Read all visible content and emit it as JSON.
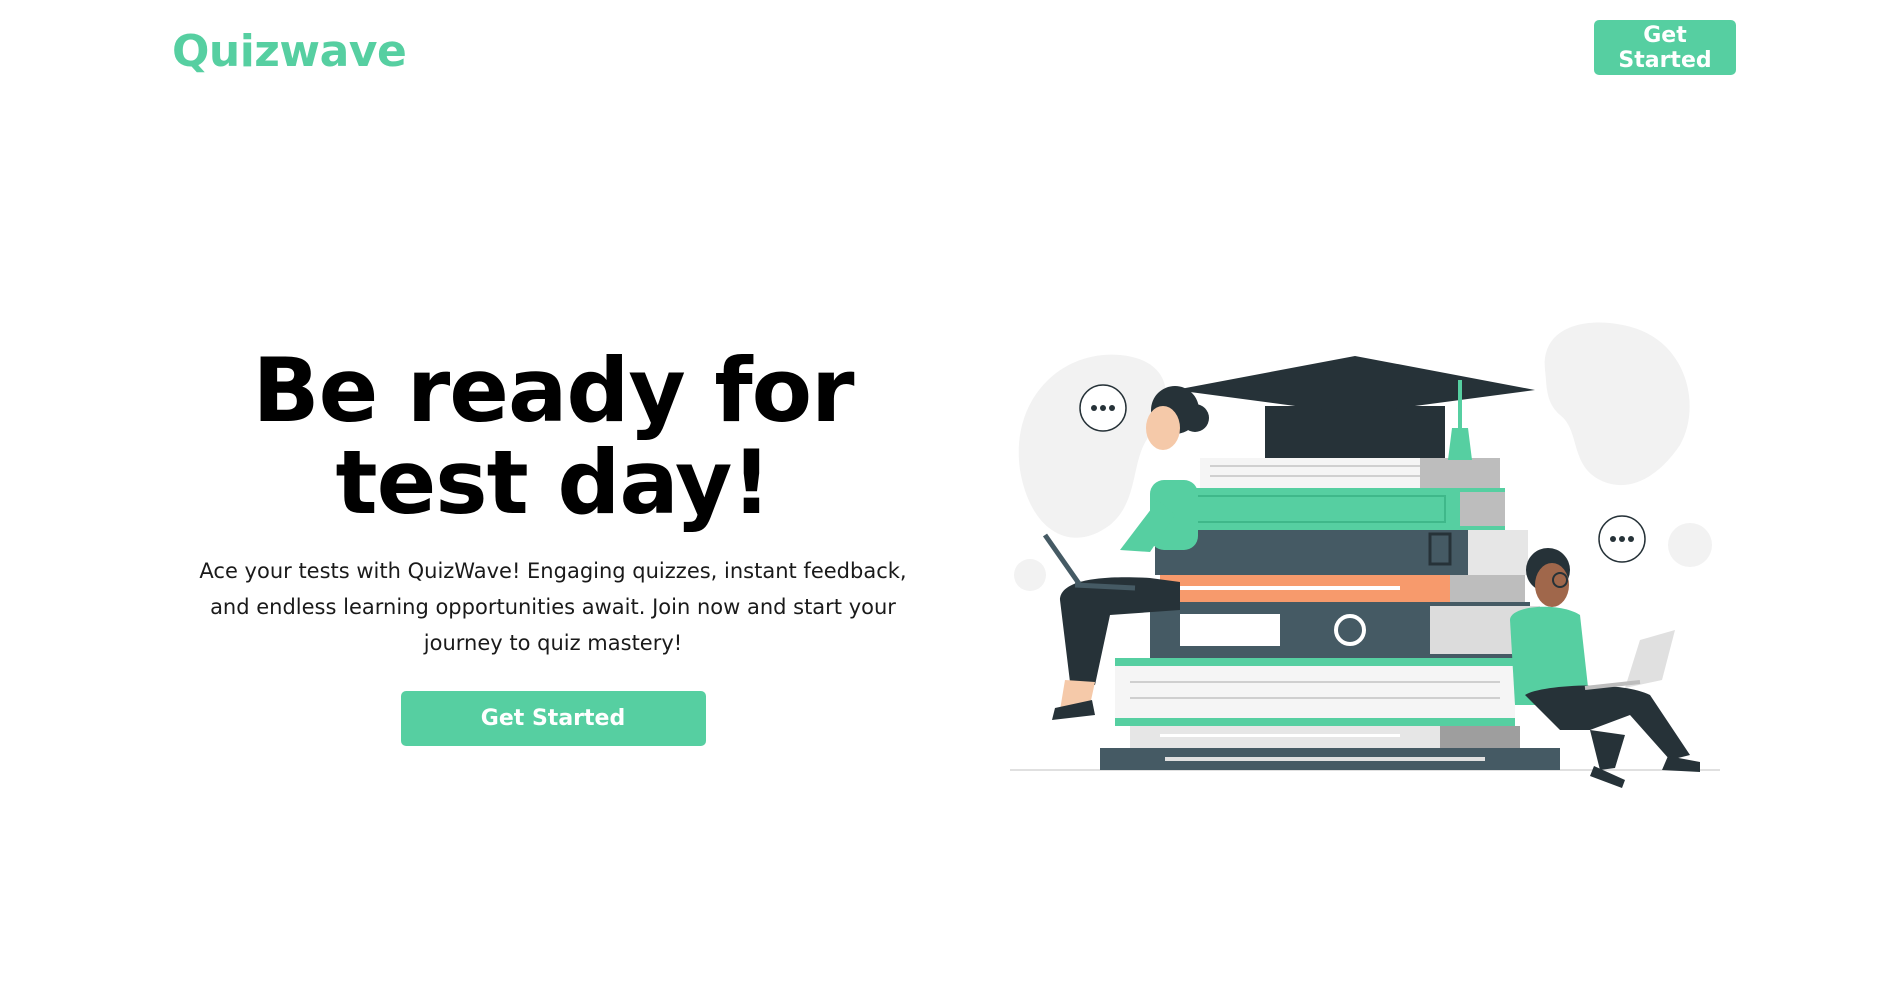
{
  "brand": {
    "name": "Quizwave"
  },
  "nav": {
    "cta_label": "Get Started"
  },
  "hero": {
    "title": "Be ready for test day!",
    "description": "Ace your tests with QuizWave! Engaging quizzes, instant feedback, and endless learning opportunities await. Join now and start your journey to quiz mastery!",
    "cta_label": "Get Started"
  },
  "illustration": {
    "icon": "students-studying-illustration",
    "speech_bubble_text": "..."
  },
  "colors": {
    "accent": "#56cfa1",
    "dark": "#263238",
    "slate": "#455a64",
    "orange": "#f79a6c",
    "blob": "#f2f2f2"
  }
}
